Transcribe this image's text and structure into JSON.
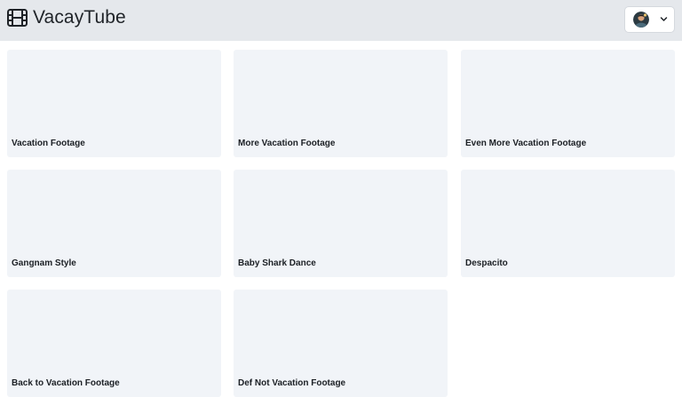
{
  "app": {
    "name": "VacayTube",
    "logo_icon": "film-reel-icon"
  },
  "header": {
    "user_menu": {
      "avatar_icon": "user-avatar",
      "chevron_icon": "chevron-down-icon"
    }
  },
  "videos": [
    {
      "title": "Vacation Footage"
    },
    {
      "title": "More Vacation Footage"
    },
    {
      "title": "Even More Vacation Footage"
    },
    {
      "title": "Gangnam Style"
    },
    {
      "title": "Baby Shark Dance"
    },
    {
      "title": "Despacito"
    },
    {
      "title": "Back to Vacation Footage"
    },
    {
      "title": "Def Not Vacation Footage"
    }
  ],
  "colors": {
    "header_bg": "#e5e8ec",
    "card_bg": "#f1f4f8",
    "text": "#1f2328"
  }
}
